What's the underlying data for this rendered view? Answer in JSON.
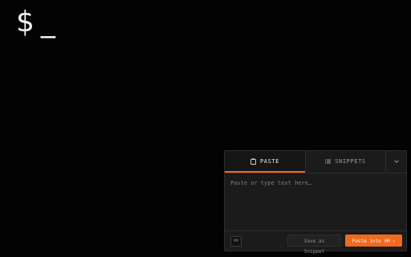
{
  "terminal": {
    "prompt_symbol": "$",
    "cursor": "_"
  },
  "panel": {
    "tabs": [
      {
        "label": "PASTE",
        "icon": "clipboard-icon",
        "active": true
      },
      {
        "label": "SNIPPETS",
        "icon": "list-icon",
        "active": false
      }
    ],
    "more_icon": "chevron-down-icon",
    "input": {
      "placeholder": "Paste or type text here…",
      "value": ""
    },
    "shortcut_label": "⌘V",
    "save_snippet_label": "Save as Snippet",
    "paste_button_label": "Paste into VM",
    "paste_button_chevron": "›"
  },
  "colors": {
    "accent": "#f06a1f",
    "background": "#030303",
    "panel": "#1b1b1b"
  }
}
